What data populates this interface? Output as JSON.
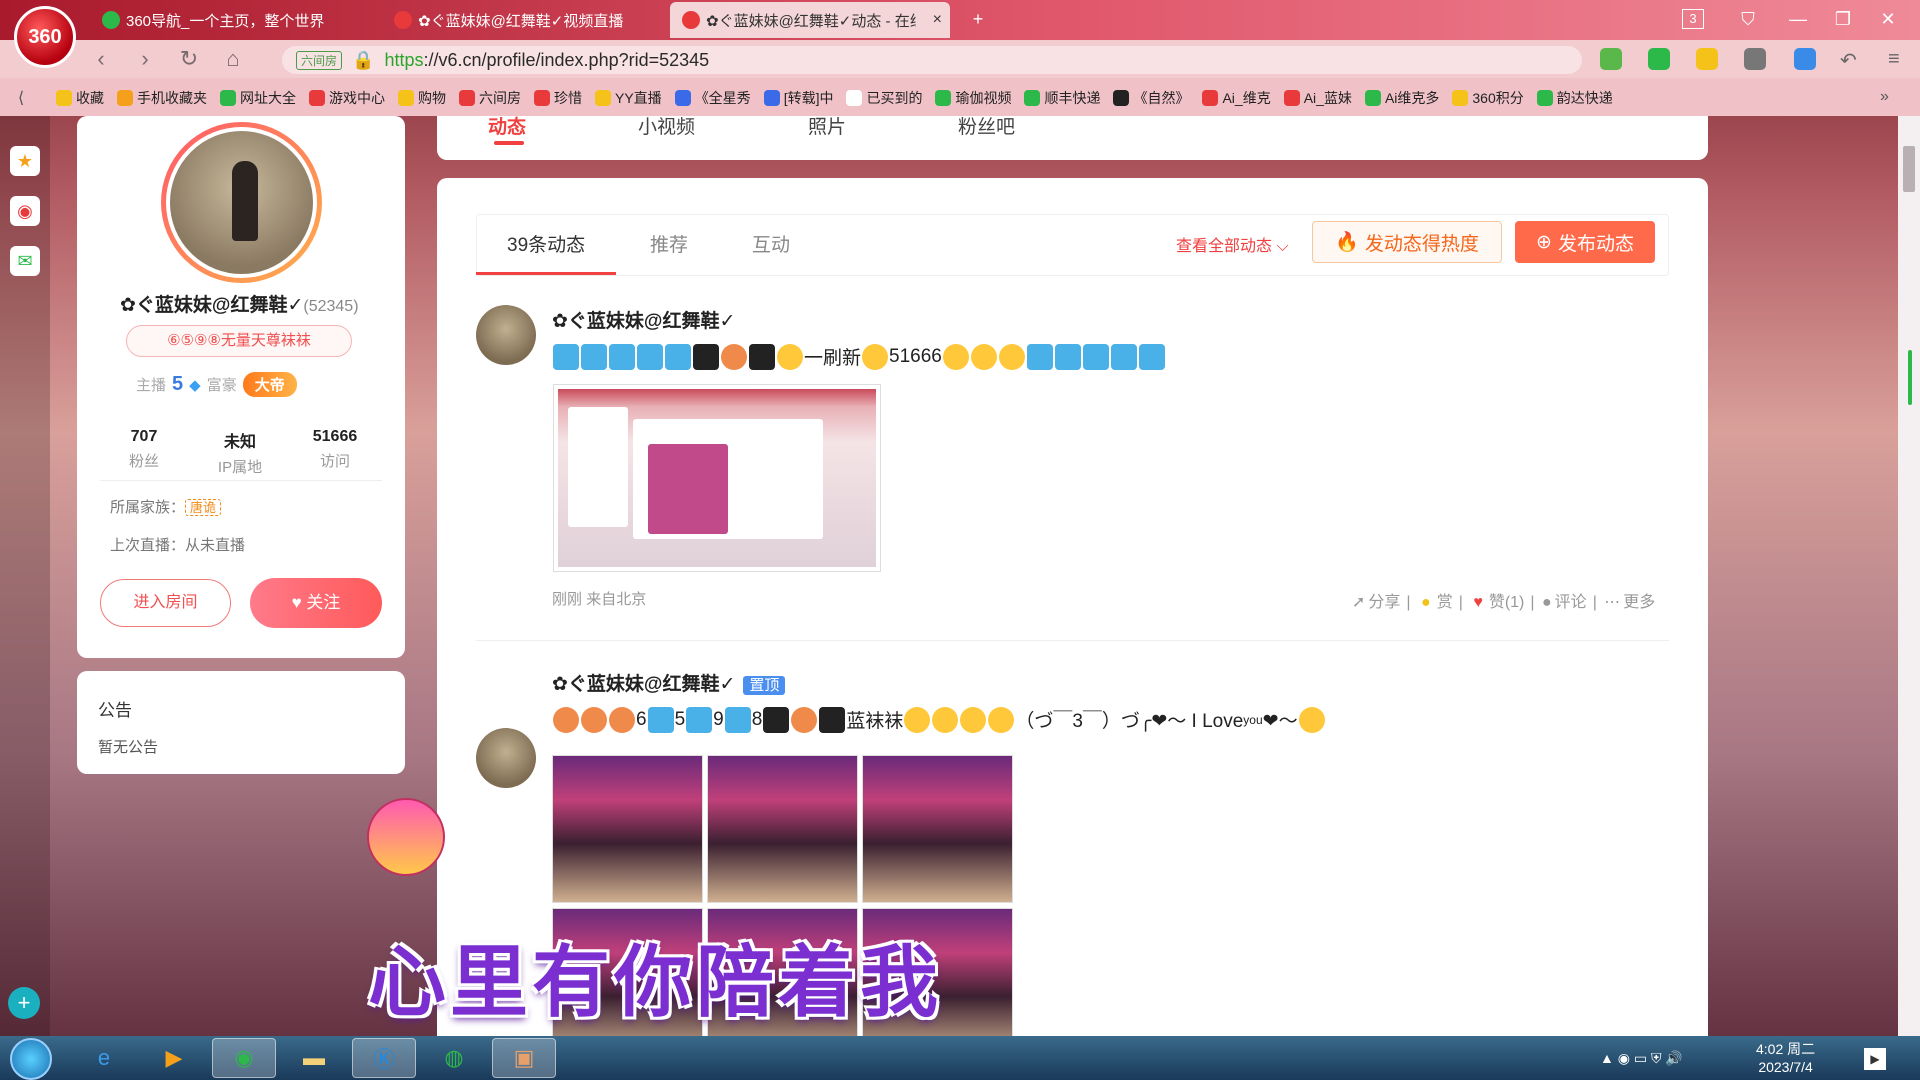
{
  "browser": {
    "logo_text": "360",
    "tabs": [
      {
        "title": "360导航_一个主页，整个世界",
        "icon_color": "#2db84a"
      },
      {
        "title": "✿ぐ蓝妹妹@红舞鞋✓视频直播",
        "icon_color": "#e83a3a"
      },
      {
        "title": "✿ぐ蓝妹妹@红舞鞋✓动态 - 在线",
        "icon_color": "#e83a3a"
      }
    ],
    "tab_close": "×",
    "new_tab": "+",
    "tab_count": "3",
    "url_cert": "六间房",
    "url_https": "https",
    "url_rest": "://v6.cn/profile/index.php?rid=52345",
    "bookmarks": [
      {
        "label": "收藏",
        "color": "#f5c21a"
      },
      {
        "label": "手机收藏夹",
        "color": "#f5a01a"
      },
      {
        "label": "网址大全",
        "color": "#2db84a"
      },
      {
        "label": "游戏中心",
        "color": "#e83a3a"
      },
      {
        "label": "购物",
        "color": "#f5c21a"
      },
      {
        "label": "六间房",
        "color": "#e83a3a"
      },
      {
        "label": "珍惜",
        "color": "#e83a3a"
      },
      {
        "label": "YY直播",
        "color": "#f5c21a"
      },
      {
        "label": "《全星秀",
        "color": "#3a6ae8"
      },
      {
        "label": "[转载]中",
        "color": "#3a6ae8"
      },
      {
        "label": "已买到的",
        "color": "#fff"
      },
      {
        "label": "瑜伽视频",
        "color": "#2db84a"
      },
      {
        "label": "顺丰快递",
        "color": "#2db84a"
      },
      {
        "label": "《自然》",
        "color": "#222"
      },
      {
        "label": "Ai_维克",
        "color": "#e83a3a"
      },
      {
        "label": "Ai_蓝妹",
        "color": "#e83a3a"
      },
      {
        "label": "Ai维克多",
        "color": "#2db84a"
      },
      {
        "label": "360积分",
        "color": "#f5c21a"
      },
      {
        "label": "韵达快递",
        "color": "#2db84a"
      }
    ]
  },
  "profile": {
    "username": "✿ぐ蓝妹妹@红舞鞋✓",
    "uid": "(52345)",
    "badge": "⑥⑤⑨⑧无量天尊袜袜",
    "anchor_label": "主播",
    "anchor_level": "5",
    "rich_label": "富豪",
    "rich_title": "大帝",
    "stats": [
      {
        "value": "707",
        "label": "粉丝"
      },
      {
        "value": "未知",
        "label": "IP属地"
      },
      {
        "value": "51666",
        "label": "访问"
      }
    ],
    "family_label": "所属家族：",
    "family_value": "唐诡",
    "last_live": "上次直播：从未直播",
    "enter_room": "进入房间",
    "follow": "关注"
  },
  "notice": {
    "title": "公告",
    "body": "暂无公告"
  },
  "top_tabs": [
    "动态",
    "小视频",
    "照片",
    "粉丝吧"
  ],
  "feed": {
    "tabs": [
      "39条动态",
      "推荐",
      "互动"
    ],
    "view_all": "查看全部动态",
    "hot_button": "发动态得热度",
    "post_button": "发布动态",
    "posts": [
      {
        "name": "✿ぐ蓝妹妹@红舞鞋✓",
        "text_mid": "一刷新",
        "text_num": "51666",
        "time": "刚刚",
        "location": "来自北京",
        "actions": {
          "share": "分享",
          "reward": "赏",
          "like": "赞(1)",
          "comment": "评论",
          "more": "更多"
        }
      },
      {
        "name": "✿ぐ蓝妹妹@红舞鞋✓",
        "pinned": "置顶",
        "text_a": "6",
        "text_b": "5",
        "text_c": "9",
        "text_d": "8",
        "text_e": "蓝袜袜",
        "text_tail": "（づ￣3￣）づ╭❤～ I Love",
        "text_you": "you",
        "text_end": "❤～"
      }
    ]
  },
  "overlay_caption": "心里有你陪着我",
  "taskbar": {
    "time": "4:02 周二",
    "date": "2023/7/4"
  }
}
